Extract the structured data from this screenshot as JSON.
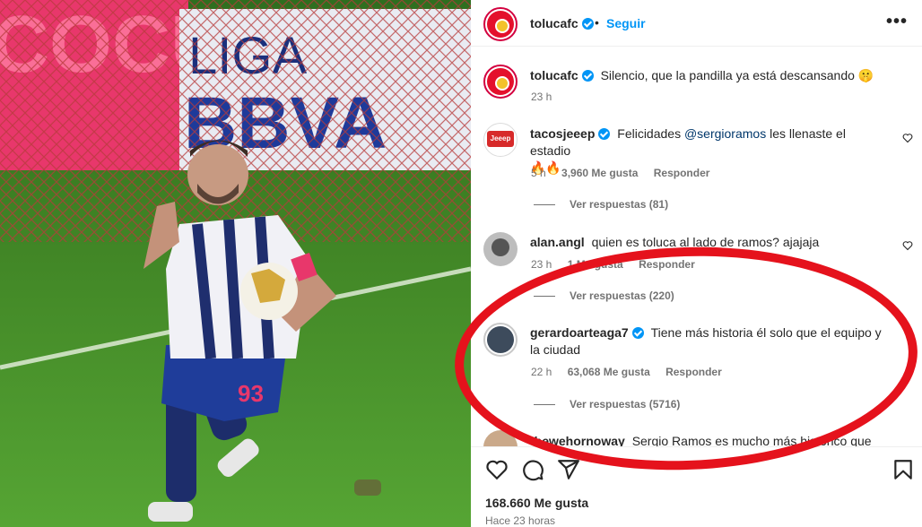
{
  "photo": {
    "description_icon": "soccer-player-photo",
    "banner_text": "LIGA BBVA",
    "jersey_number": "93",
    "sponsor_text": "COCU"
  },
  "header": {
    "username": "tolucafc",
    "separator": "•",
    "follow_label": "Seguir",
    "more_icon": "more-dots-icon"
  },
  "caption": {
    "username": "tolucafc",
    "text": "Silencio, que la pandilla ya está descansando 🤫",
    "time": "23 h"
  },
  "comments": [
    {
      "username": "tacosjeeep",
      "mention": "@sergioramos",
      "text_before": "Felicidades ",
      "text_after": " les llenaste el estadio",
      "text_line2": "🔥🔥",
      "time": "5 h",
      "likes": "3,960 Me gusta",
      "reply": "Responder",
      "view_replies": "Ver respuestas (81)"
    },
    {
      "username": "alan.angl",
      "text": "quien es toluca al lado de ramos? ajajaja",
      "time": "23 h",
      "likes": "1 Me gusta",
      "reply": "Responder",
      "view_replies": "Ver respuestas (220)"
    },
    {
      "username": "gerardoarteaga7",
      "text": "Tiene más historia él solo que el equipo y",
      "text_line2": "la ciudad",
      "time": "22 h",
      "likes": "63,068 Me gusta",
      "reply": "Responder",
      "view_replies": "Ver respuestas (5716)"
    },
    {
      "username": "thewehornoway",
      "text": "Sergio Ramos es mucho más histórico que"
    }
  ],
  "footer": {
    "likes": "168.660 Me gusta",
    "time": "Hace 23 horas"
  },
  "colors": {
    "accent": "#0095f6",
    "annotation": "#e5121c",
    "toluca_red": "#d3013f"
  }
}
